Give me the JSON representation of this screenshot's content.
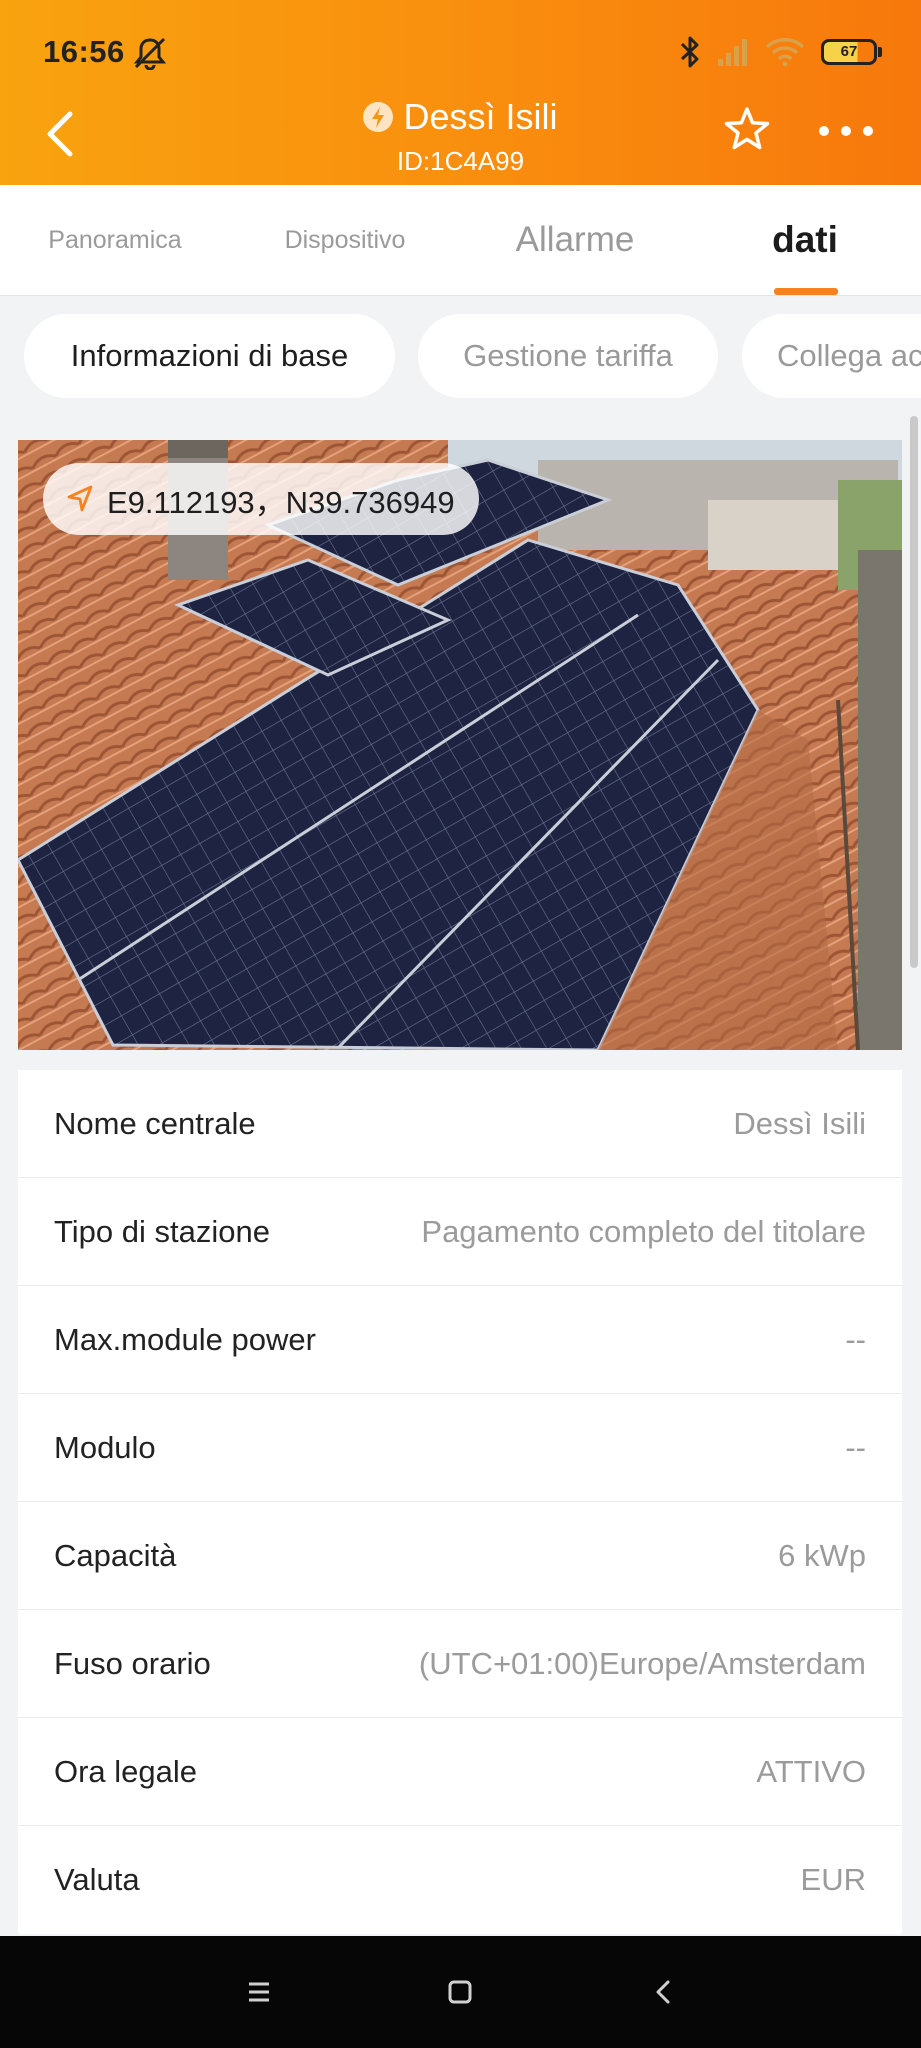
{
  "status_bar": {
    "time": "16:56",
    "battery": "67",
    "icons": [
      "mute-icon",
      "bluetooth-icon",
      "signal-icon",
      "wifi-icon",
      "battery-icon"
    ]
  },
  "header": {
    "title": "Dessì Isili",
    "plant_id": "ID:1C4A99",
    "accent_color": "#f98d0e"
  },
  "tabs": [
    {
      "label": "Panoramica",
      "active": false
    },
    {
      "label": "Dispositivo",
      "active": false
    },
    {
      "label": "Allarme",
      "active": false
    },
    {
      "label": "dati",
      "active": true
    }
  ],
  "chips": [
    {
      "label": "Informazioni di base",
      "active": true
    },
    {
      "label": "Gestione tariffa",
      "active": false
    },
    {
      "label": "Collega ac",
      "active": false
    }
  ],
  "photo": {
    "coordinates": "E9.112193，N39.736949"
  },
  "info_rows": [
    {
      "label": "Nome centrale",
      "value": "Dessì Isili"
    },
    {
      "label": "Tipo di stazione",
      "value": "Pagamento completo del titolare"
    },
    {
      "label": "Max.module power",
      "value": "--"
    },
    {
      "label": "Modulo",
      "value": "--"
    },
    {
      "label": "Capacità",
      "value": "6 kWp"
    },
    {
      "label": "Fuso orario",
      "value": "(UTC+01:00)Europe/Amsterdam"
    },
    {
      "label": "Ora legale",
      "value": "ATTIVO"
    },
    {
      "label": "Valuta",
      "value": "EUR"
    }
  ]
}
